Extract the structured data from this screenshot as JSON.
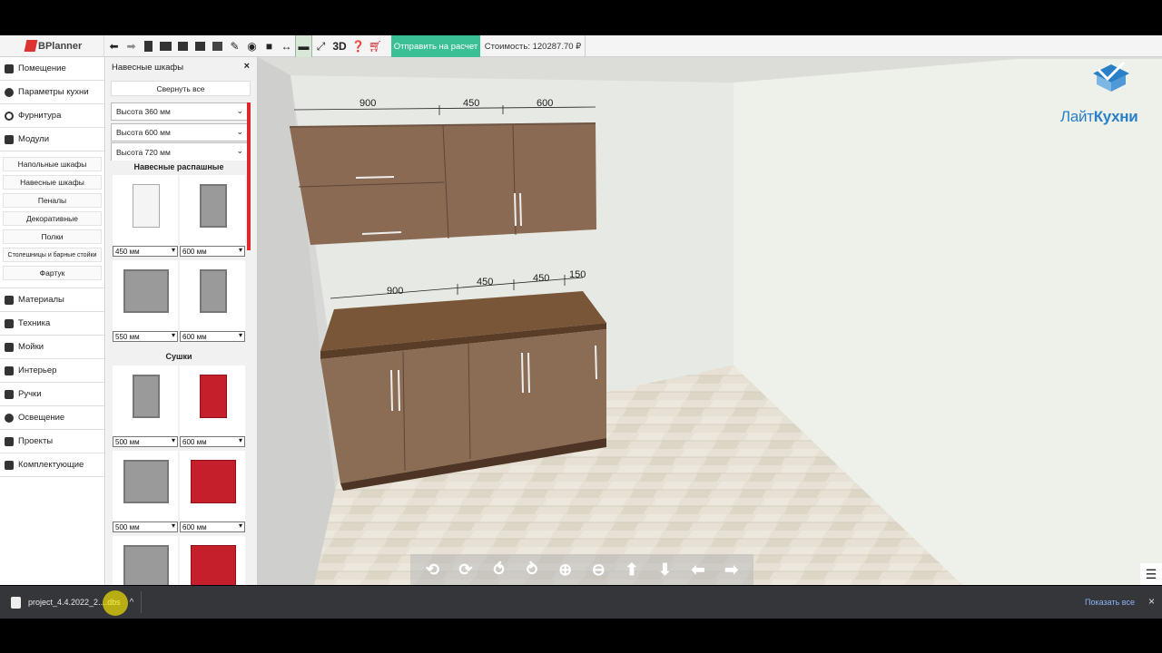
{
  "app": {
    "logo_text": "BPlanner"
  },
  "toolbar": {
    "icons": [
      "back-arrow-icon",
      "forward-arrow-icon",
      "new-file-icon",
      "open-folder-icon",
      "save-icon",
      "print-icon",
      "image-icon",
      "pen-icon",
      "eye-icon",
      "camera-icon",
      "resize-arrows-icon",
      "comment-icon",
      "fullscreen-icon",
      "3d-label",
      "help-icon",
      "cart-icon"
    ],
    "label_3d": "3D",
    "send_label": "Отправить на расчет",
    "cost_label": "Стоимость: 120287.70 ₽",
    "send_color": "#3bbf95"
  },
  "menu": {
    "items_top": [
      "Помещение",
      "Параметры кухни",
      "Фурнитура",
      "Модули"
    ],
    "subitems": [
      "Напольные шкафы",
      "Навесные шкафы",
      "Пеналы",
      "Декоративные",
      "Полки",
      "Столешницы и барные стойки",
      "Фартук"
    ],
    "items_bottom": [
      "Материалы",
      "Техника",
      "Мойки",
      "Интерьер",
      "Ручки",
      "Освещение",
      "Проекты",
      "Комплектующие"
    ]
  },
  "panel": {
    "title": "Навесные шкафы",
    "close": "×",
    "collapse_label": "Свернуть все",
    "accordions": [
      "Высота 360 мм",
      "Высота 600 мм",
      "Высота 720 мм"
    ],
    "section1": "Навесные распашные",
    "section2": "Сушки",
    "cards": [
      {
        "size": "450 мм",
        "style": "white"
      },
      {
        "size": "600 мм",
        "style": "glass"
      },
      {
        "size": "550 мм",
        "style": "glass"
      },
      {
        "size": "600 мм",
        "style": "glass"
      },
      {
        "size": "500 мм",
        "style": "glass"
      },
      {
        "size": "600 мм",
        "style": "red"
      },
      {
        "size": "500 мм",
        "style": "glass"
      },
      {
        "size": "600 мм",
        "style": "red"
      }
    ]
  },
  "scene": {
    "upper_dims": [
      "900",
      "450",
      "600"
    ],
    "lower_dims": [
      "900",
      "450",
      "450",
      "150"
    ],
    "wood_color": "#8a6a52",
    "countertop_color": "#7a5638"
  },
  "brand": {
    "text_light": "Лайт",
    "text_bold": "Кухни",
    "color": "#2980c8"
  },
  "navbar": [
    "rotate-left-icon",
    "rotate-right-icon",
    "rotate-up-icon",
    "rotate-down-icon",
    "zoom-in-icon",
    "zoom-out-icon",
    "arrow-up-icon",
    "arrow-down-icon",
    "arrow-left-icon",
    "arrow-right-icon"
  ],
  "download": {
    "filename": "project_4.4.2022_2....dbs",
    "show_all": "Показать все",
    "close": "×"
  }
}
